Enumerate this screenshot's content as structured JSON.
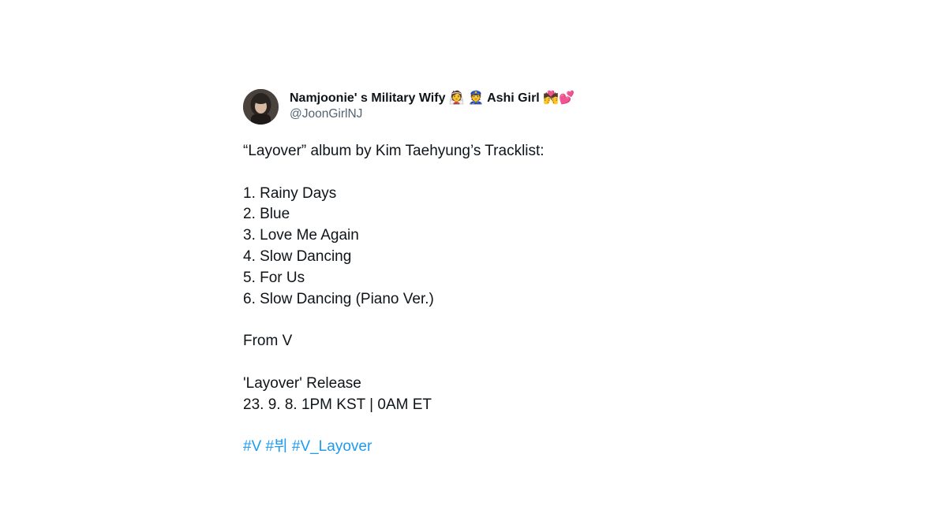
{
  "tweet": {
    "author": {
      "display_name": "Namjoonie' s Military Wify 👰 👮 Ashi Girl 💏💕",
      "handle": "@JoonGirlNJ",
      "avatar_icon": "profile-photo"
    },
    "intro": "“Layover” album by Kim Taehyung’s Tracklist:",
    "tracks": [
      "1. Rainy Days",
      "2. Blue",
      "3. Love Me Again",
      "4. Slow Dancing",
      "5. For Us",
      "6. Slow Dancing (Piano Ver.)"
    ],
    "from": "From V",
    "release_title": "'Layover' Release",
    "release_time": "23. 9. 8. 1PM KST | 0AM ET",
    "hashtags": [
      "#V",
      "#뷔",
      "#V_Layover"
    ],
    "link_color": "#1d9bf0"
  }
}
